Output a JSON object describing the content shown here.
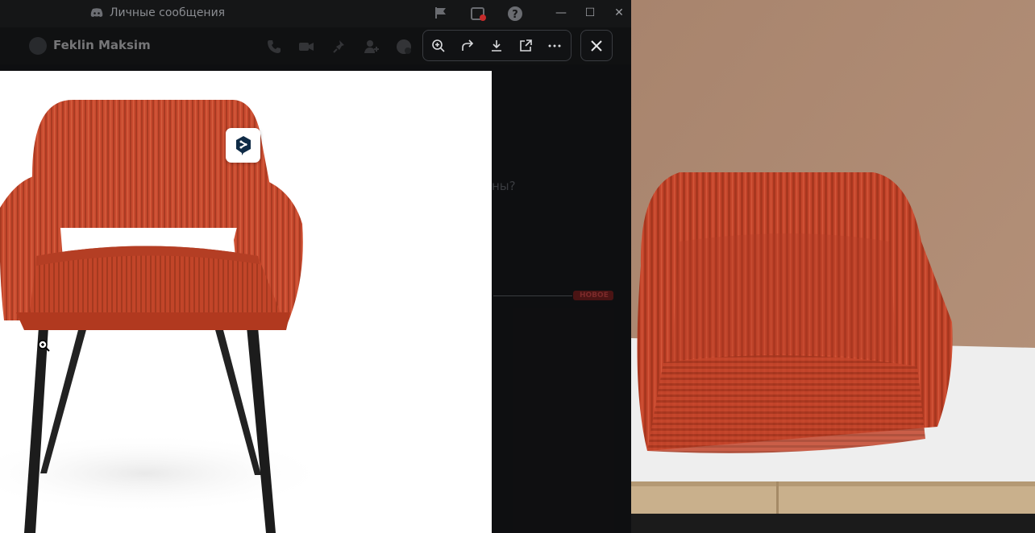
{
  "window": {
    "title": "Личные сообщения",
    "controls": {
      "minimize": "—",
      "maximize": "☐",
      "close": "✕"
    }
  },
  "chat": {
    "contact_name": "Feklin Maksim",
    "partial_message": "ны?",
    "new_badge": "НОВОЕ"
  },
  "viewer": {
    "toolbar_icons": [
      "zoom-in-icon",
      "forward-icon",
      "download-icon",
      "open-external-icon",
      "more-icon"
    ],
    "close_icon": "close-icon"
  },
  "colors": {
    "chair": "#c4452b",
    "legs": "#1a1a1a",
    "photo_wall": "#a8846d",
    "toolbar_bg": "#111214",
    "window_bg": "#1b1c1f"
  }
}
